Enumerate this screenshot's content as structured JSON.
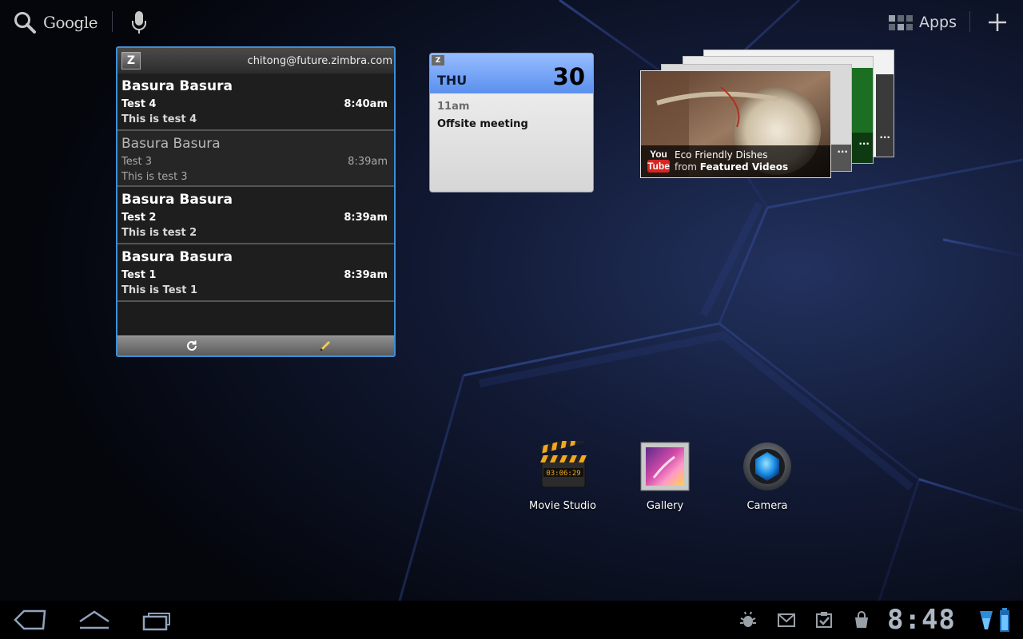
{
  "topbar": {
    "search_label": "Google",
    "apps_label": "Apps"
  },
  "mail_widget": {
    "account": "chitong@future.zimbra.com",
    "logo_text": "Z",
    "messages": [
      {
        "sender": "Basura Basura",
        "subject": "Test 4",
        "time": "8:40am",
        "preview": "This is test 4",
        "unread": true
      },
      {
        "sender": "Basura Basura",
        "subject": "Test 3",
        "time": "8:39am",
        "preview": "This is test 3",
        "unread": false
      },
      {
        "sender": "Basura Basura",
        "subject": "Test 2",
        "time": "8:39am",
        "preview": "This is test 2",
        "unread": true
      },
      {
        "sender": "Basura Basura",
        "subject": "Test 1",
        "time": "8:39am",
        "preview": "This is Test 1",
        "unread": true
      }
    ]
  },
  "calendar_widget": {
    "logo_text": "Z",
    "day": "THU",
    "date": "30",
    "event_time": "11am",
    "event_title": "Offsite meeting"
  },
  "youtube_widget": {
    "logo_top": "You",
    "logo_bottom": "Tube",
    "video_title": "Eco Friendly Dishes",
    "from_prefix": "from",
    "channel": "Featured Videos",
    "more": "..."
  },
  "shortcuts": [
    {
      "label": "Movie Studio",
      "icon": "movie-studio-icon",
      "clapper_time": "03:06:29"
    },
    {
      "label": "Gallery",
      "icon": "gallery-icon"
    },
    {
      "label": "Camera",
      "icon": "camera-icon"
    }
  ],
  "system_bar": {
    "clock": "8:48",
    "notifications": [
      "debug-icon",
      "gmail-icon",
      "tasks-icon",
      "market-icon"
    ],
    "wifi_icon": "wifi-icon",
    "battery_icon": "battery-icon"
  },
  "colors": {
    "widget_border": "#3d8fd8",
    "calendar_header": "#6e9ff5",
    "youtube_red": "#d9231f",
    "clock": "#aeb8c4"
  }
}
